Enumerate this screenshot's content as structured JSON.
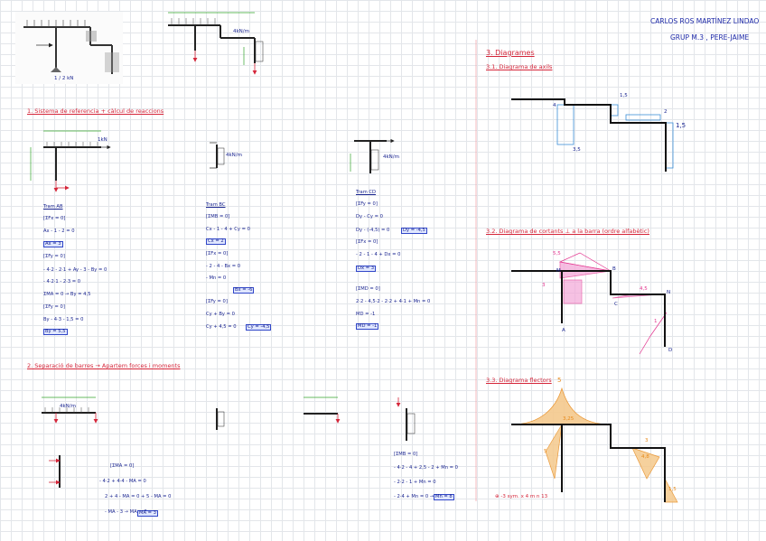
{
  "header": {
    "author": "CARLOS ROS MARTÍNEZ LINDAO",
    "group": "GRUP M.3 , PERE-JAIME"
  },
  "sections": {
    "s1": "1. Sistema de referencia + càlcul de reaccions",
    "s2": "2. Separació de barres → Apartem forces i moments",
    "s3": "3. Diagrames",
    "s31": "3.1. Diagrama de axils",
    "s32": "3.2. Diagrama de cortants  ⊥ a la barra (ordre alfabètic)",
    "s33": "3.3. Diagrama flectors"
  },
  "labels": {
    "load": "4kN/m",
    "load2": "1kN",
    "scale": "1 / 2 kN",
    "legend": "⊕ -3 sym. x 4 m n 13"
  },
  "point_labels": [
    "A",
    "B",
    "C",
    "D",
    "M",
    "N"
  ],
  "axial_values": [
    "1,5",
    "2",
    "1,5",
    "3,5",
    "4",
    "2"
  ],
  "shear_values": [
    "5,5",
    "3",
    "4,5",
    "1",
    "2",
    "3"
  ],
  "moment_values": [
    "5",
    "5",
    "3,25",
    "4,8",
    "1,5",
    "3"
  ],
  "col1": {
    "title": "Tram AB",
    "eqs": [
      "[ΣFx = 0]",
      "Ax - 1 - 2 = 0",
      "Ax = 3",
      "[ΣFy = 0]",
      "- 4·2 - 2·1 + Ay - 3 - By = 0",
      "- 4·2·1 - 2·3 = 0",
      "ΣMA = 0 → By = 4,5",
      "[ΣFy = 0]",
      "By - 4·3 - 1,5 = 0",
      "By = 5,5"
    ],
    "boxes": [
      "Ax = 3",
      "Ay = 3",
      "By = 5,5"
    ]
  },
  "col2": {
    "title": "Tram BC",
    "eqs": [
      "[ΣMB = 0]",
      "Cx - 1 - 4 + Cy = 0",
      "Cx = 2",
      "[ΣFx = 0]",
      "- 2 - 4 - Bx = 0",
      "Bx = -6",
      "- Mn = 0",
      "[ΣFy = 0]",
      "Cy + By = 0",
      "Cy + 4,5 = 0"
    ],
    "boxes": [
      "Cx = 2",
      "Bx = -6",
      "Cy = -4,5"
    ]
  },
  "col3": {
    "title": "Tram CD",
    "eqs": [
      "[ΣFy = 0]",
      "Dy - Cy = 0",
      "Dy - (-4,5) = 0",
      "[ΣFx = 0]",
      "- 2 - 1 - 4 + Dx = 0",
      "Dx = 3",
      "[ΣMD = 0]",
      "2·2 - 4,5·2 - 2·2 + 4·1 + Mn = 0",
      "MD = -1"
    ],
    "boxes": [
      "Dy = -4,5",
      "Dx = 3",
      "MD = -1"
    ]
  },
  "col4": {
    "eqs": [
      "[ΣMA = 0]",
      "- 4·2 + 4·4 - MA = 0",
      "2 + 4 - MA = 0 + 5 - MA = 0",
      "- MA - 3 → MA = 3"
    ],
    "boxes": [
      "MA = 3"
    ]
  },
  "col5": {
    "eqs": [
      "[ΣMB = 0]",
      "- 4·2 - 4 + 2,5 - 2 + Mn = 0",
      "- 2·2 - 1 + Mn = 0",
      "- 2·4 + Mn = 0 → Mn = 8"
    ],
    "boxes": [
      "Mn = 8"
    ]
  }
}
